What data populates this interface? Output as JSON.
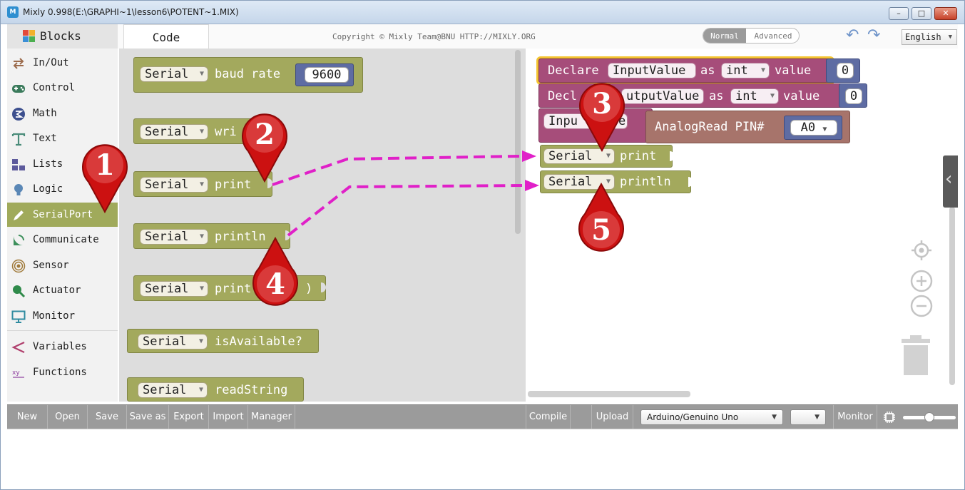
{
  "window": {
    "title": "Mixly 0.998(E:\\GRAPHI~1\\lesson6\\POTENT~1.MIX)",
    "app_icon": "M",
    "controls": [
      "minimize-icon",
      "maximize-icon",
      "close-icon"
    ]
  },
  "toolbar": {
    "tab_blocks": "Blocks",
    "tab_code": "Code",
    "copyright": "Copyright © Mixly Team@BNU HTTP://MIXLY.ORG",
    "mode_normal": "Normal",
    "mode_advanced": "Advanced",
    "language": "English",
    "undo_icon": "↶",
    "redo_icon": "↷"
  },
  "sidebar": {
    "items": [
      {
        "label": "In/Out",
        "icon": "arrows-icon",
        "color": "#9c6b4c"
      },
      {
        "label": "Control",
        "icon": "gamepad-icon",
        "color": "#3a7a5b"
      },
      {
        "label": "Math",
        "icon": "math-icon",
        "color": "#3c4f8e"
      },
      {
        "label": "Text",
        "icon": "text-icon",
        "color": "#4a8c7a"
      },
      {
        "label": "Lists",
        "icon": "lists-icon",
        "color": "#5d5a9c"
      },
      {
        "label": "Logic",
        "icon": "bulb-icon",
        "color": "#5a87b6"
      },
      {
        "label": "SerialPort",
        "icon": "pen-icon",
        "color": "#ffffff",
        "selected": true
      },
      {
        "label": "Communicate",
        "icon": "satellite-icon",
        "color": "#3c8f5b"
      },
      {
        "label": "Sensor",
        "icon": "sensor-icon",
        "color": "#a07a3a"
      },
      {
        "label": "Actuator",
        "icon": "actuator-icon",
        "color": "#2f8a4a"
      },
      {
        "label": "Monitor",
        "icon": "monitor-icon",
        "color": "#2f8ba0"
      },
      {
        "label": "Variables",
        "icon": "variables-icon",
        "color": "#b03f6d"
      },
      {
        "label": "Functions",
        "icon": "functions-icon",
        "color": "#8f3f9f"
      }
    ]
  },
  "flyout": {
    "serial_label": "Serial",
    "baud_rate_label": "baud rate",
    "baud_rate_value": "9600",
    "write_label": "wri",
    "print_label": "print",
    "println_label": "println",
    "print_partial_label": "print",
    "print_partial_suffix": ")",
    "available_label": "isAvailable?",
    "readstring_label": "readString"
  },
  "workspace": {
    "declare_label": "Declare",
    "decl_partial": "Decl",
    "var1": "InputValue",
    "var2_partial": "utputValue",
    "as_label": "as",
    "type_int": "int",
    "value_label": "value",
    "num_zero": "0",
    "input_partial": "Inpu",
    "input_tail": "e",
    "analogread_label": "AnalogRead PIN#",
    "pin": "A0",
    "serial_label": "Serial",
    "print_label": "print",
    "println_label": "println"
  },
  "badges": [
    "1",
    "2",
    "3",
    "4",
    "5"
  ],
  "bottom_bar": {
    "new": "New",
    "open": "Open",
    "save": "Save",
    "save_as": "Save as",
    "export": "Export",
    "import": "Import",
    "manager": "Manager",
    "compile": "Compile",
    "upload": "Upload",
    "board": "Arduino/Genuino Uno",
    "port": "",
    "monitor": "Monitor"
  },
  "colors": {
    "serial_block": "#a3a95d",
    "declare_block": "#a64d7a",
    "analog_block": "#a7746b",
    "number_block": "#5e6ca3",
    "arrow": "#e020c8",
    "badge": "#cc1111"
  }
}
